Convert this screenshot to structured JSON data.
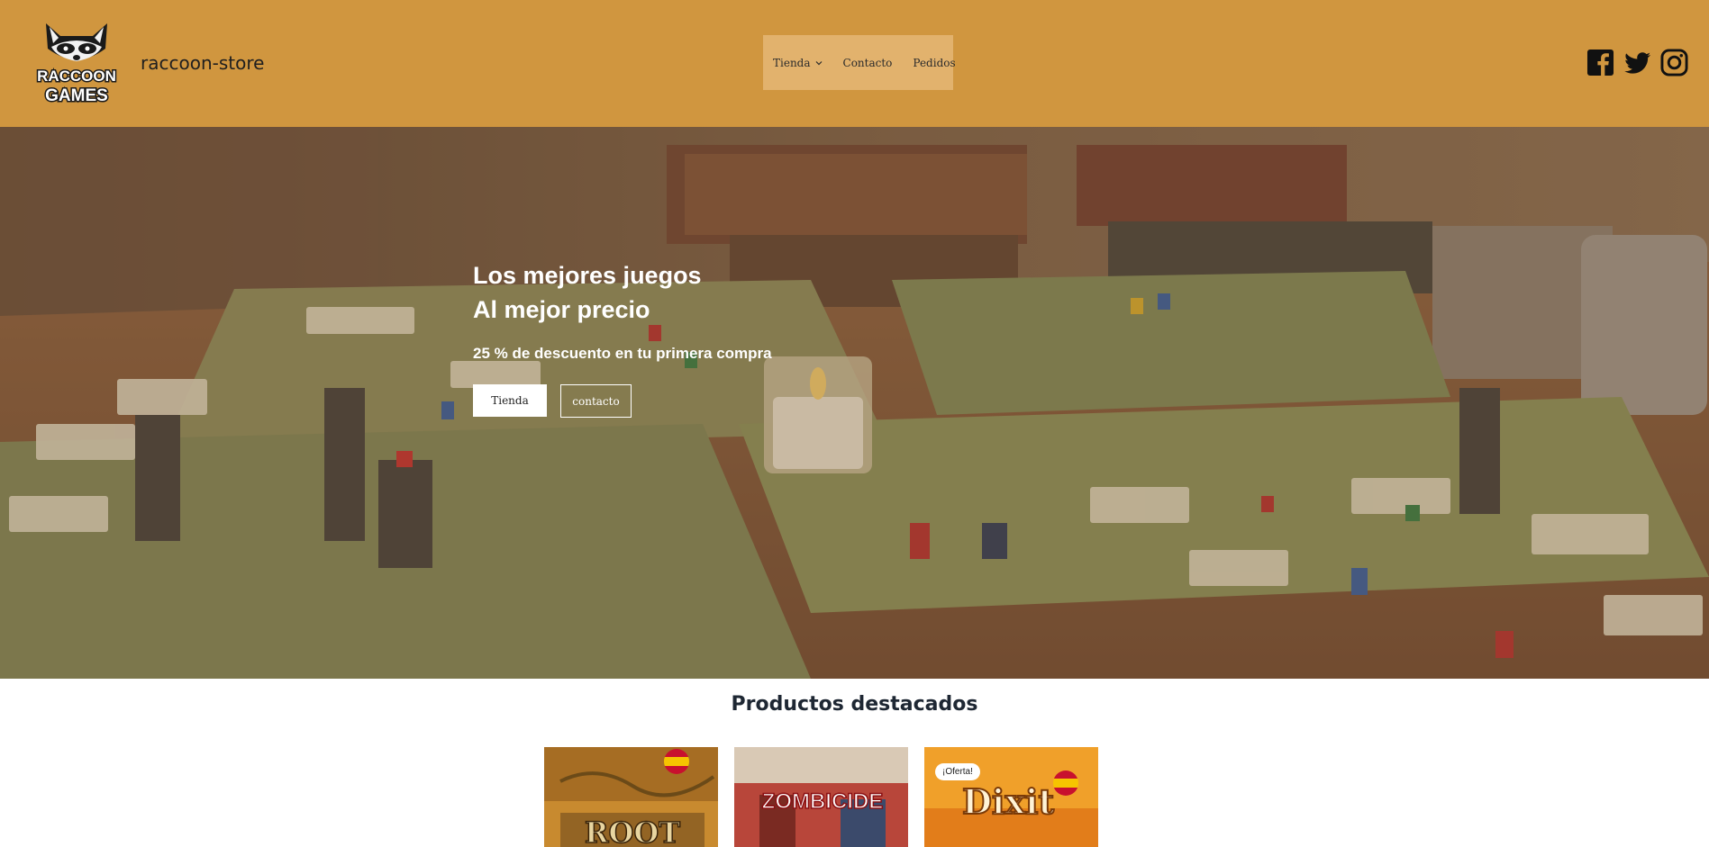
{
  "header": {
    "logo_text_line1": "RACCOON",
    "logo_text_line2": "GAMES",
    "site_title": "raccoon-store",
    "nav": [
      {
        "label": "Tienda",
        "has_dropdown": true
      },
      {
        "label": "Contacto"
      },
      {
        "label": "Pedidos"
      }
    ],
    "socials": [
      "facebook-icon",
      "twitter-icon",
      "instagram-icon"
    ]
  },
  "hero": {
    "title_line1": "Los mejores juegos",
    "title_line2": "Al mejor precio",
    "subtitle": "25 % de descuento en tu primera compra",
    "button_primary": "Tienda",
    "button_secondary": "contacto"
  },
  "featured": {
    "title": "Productos destacados",
    "products": [
      {
        "name": "ROOT",
        "flag": "es"
      },
      {
        "name": "ZOMBICIDE",
        "flag": ""
      },
      {
        "name": "Dixit",
        "flag": "es",
        "badge": "¡Oferta!"
      }
    ]
  },
  "colors": {
    "header_bg": "#d0963f",
    "nav_bg": "#e2b26d"
  }
}
